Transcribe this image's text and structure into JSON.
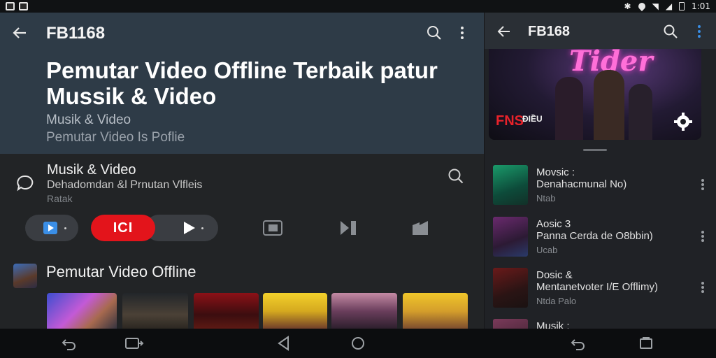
{
  "status_bar": {
    "time": "1:01"
  },
  "left": {
    "app_title": "FB1168",
    "hero": {
      "title": "Pemutar Video Offline Terbaik patur Mussik & Video",
      "subtitle_1": "Musik & Video",
      "subtitle_2": "Pemutar Video Is Poflie"
    },
    "info": {
      "title": "Musik & Video",
      "line_1": "Dehadomdan &l Prnutan Vlfleis",
      "line_2": "Ratak"
    },
    "controls": {
      "red_label": "ICI"
    },
    "section_title": "Pemutar Video Offline"
  },
  "right": {
    "app_title": "FB168",
    "banner": {
      "neon_text": "Tider",
      "badge_text": "FNS",
      "badge_sub": "ĐIỀU"
    },
    "rows": [
      {
        "line_1": "Movsic :",
        "line_2": "Denahacmunal No)",
        "line_3": "Ntab"
      },
      {
        "line_1": "Aosic 3",
        "line_2": "Panna Cerda de O8bbin)",
        "line_3": "Ucab"
      },
      {
        "line_1": "Dosic &",
        "line_2": "Mentanetvoter I/E Offlimy)",
        "line_3": "Ntda Palo"
      },
      {
        "line_1": "Musik ;",
        "line_2": "",
        "line_3": ""
      }
    ]
  },
  "colors": {
    "accent_red": "#e3141b",
    "hero_bg": "#2e3b47",
    "accent_blue": "#3a8ee6"
  },
  "icons": [
    "back-arrow-icon",
    "search-icon",
    "more-vert-icon",
    "chat-bubble-icon",
    "settings-icon",
    "nav-back-icon",
    "nav-home-icon",
    "nav-recents-icon"
  ]
}
